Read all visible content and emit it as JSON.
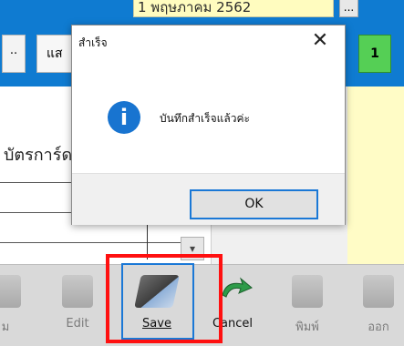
{
  "background": {
    "date_value": "1 พฤษภาคม 2562",
    "date_button": "...",
    "dots_button": "..",
    "show_button": "แส",
    "counter": "1",
    "card_label": "บัตรการ์ด",
    "dropdown_icon": "chevron-down-icon"
  },
  "toolbar": {
    "items": [
      {
        "label": "ม"
      },
      {
        "label": "Edit"
      },
      {
        "label": "Save"
      },
      {
        "label": "Cancel"
      },
      {
        "label": "พิมพ์"
      },
      {
        "label": "ออก"
      }
    ]
  },
  "dialog": {
    "title": "สำเร็จ",
    "close_symbol": "✕",
    "icon": "info-icon",
    "message": "บันทึกสำเร็จแล้วค่ะ",
    "ok_label": "OK"
  },
  "colors": {
    "accent": "#1a78d6",
    "highlight": "#ff1010",
    "info": "#1874d0"
  }
}
